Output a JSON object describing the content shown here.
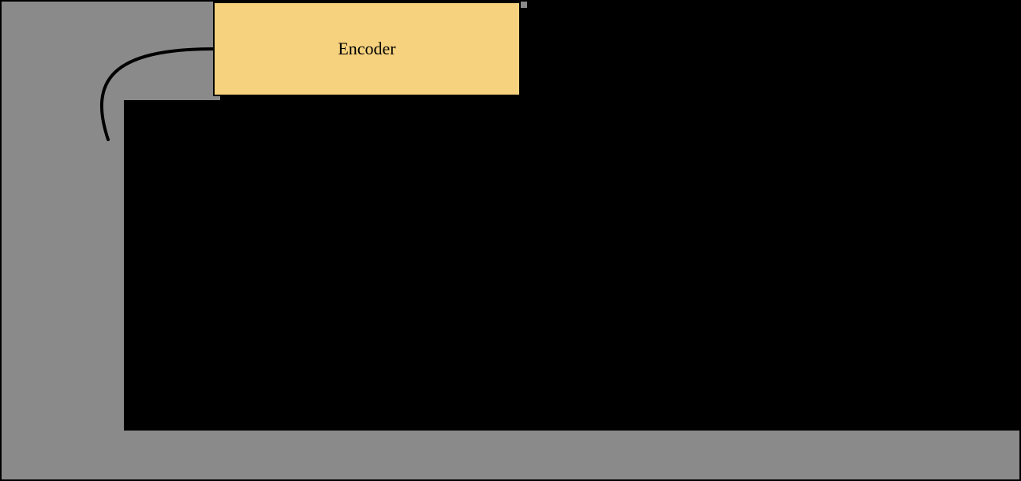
{
  "diagram": {
    "encoder_label": "Encoder"
  }
}
